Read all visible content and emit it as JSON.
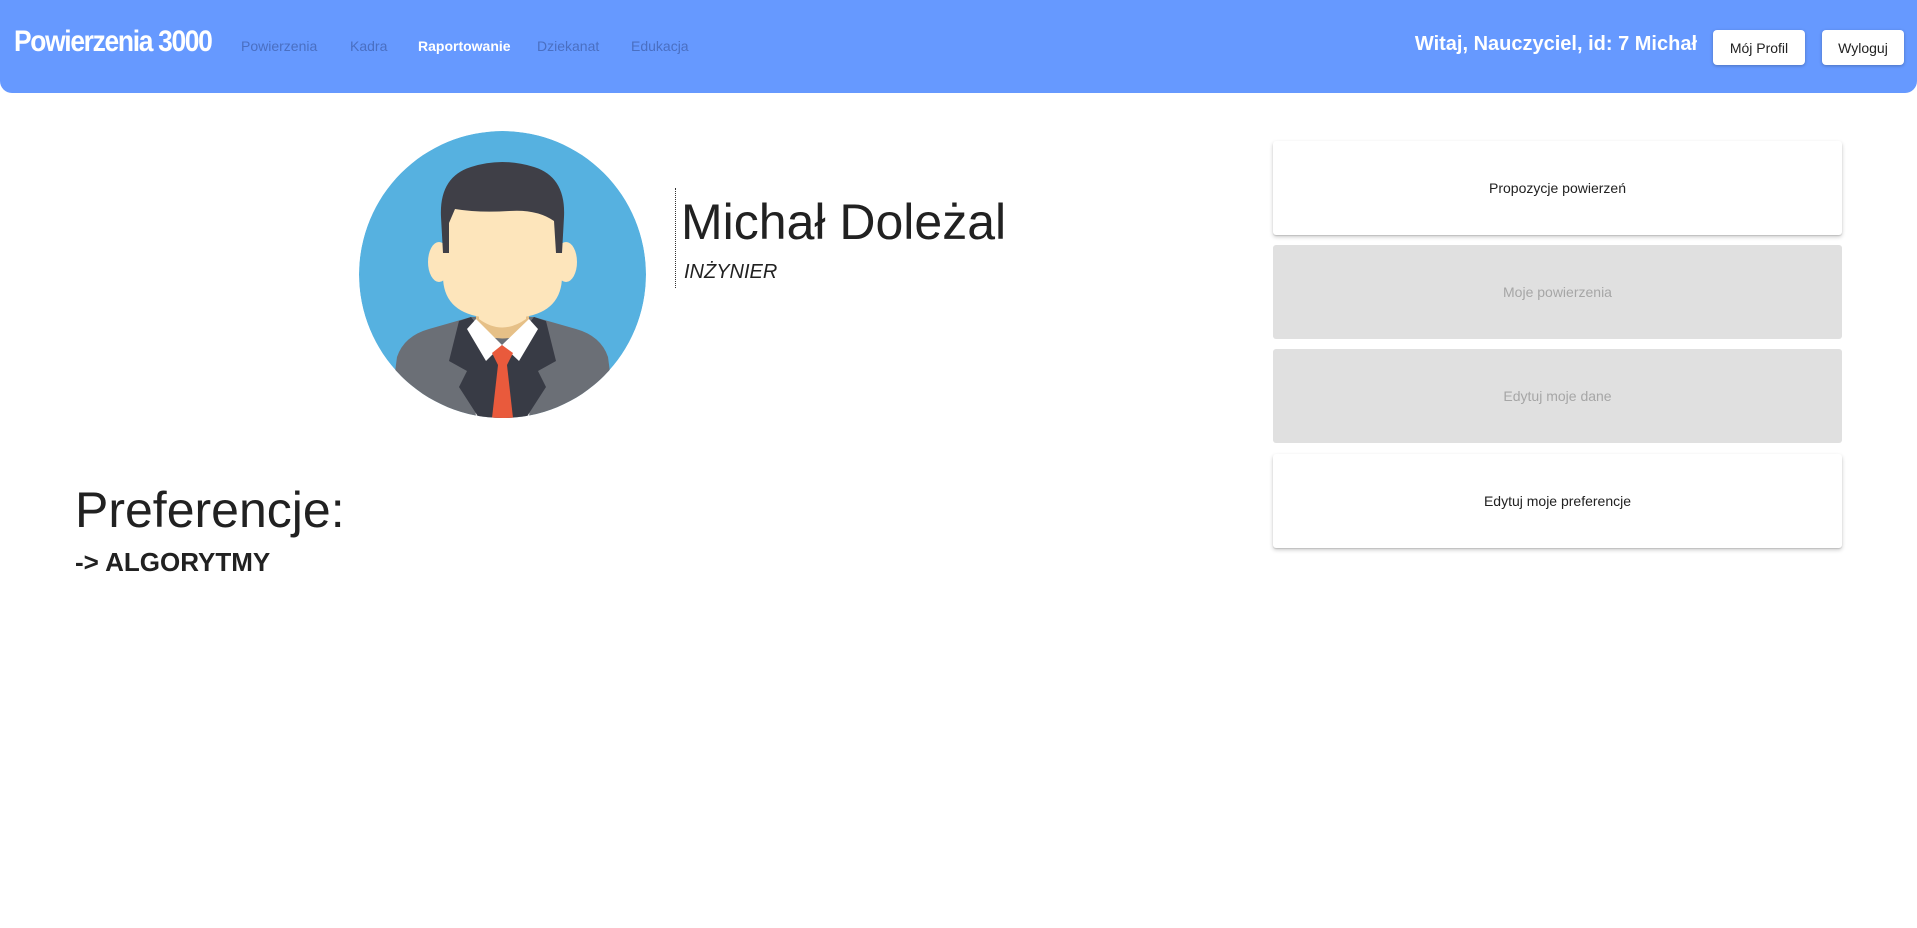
{
  "header": {
    "brand": "Powierzenia 3000",
    "nav": [
      {
        "label": "Powierzenia",
        "active": false
      },
      {
        "label": "Kadra",
        "active": false
      },
      {
        "label": "Raportowanie",
        "active": true
      },
      {
        "label": "Dziekanat",
        "active": false
      },
      {
        "label": "Edukacja",
        "active": false
      }
    ],
    "greeting": "Witaj, Nauczyciel, id: 7 Michał",
    "profile_button": "Mój Profil",
    "logout_button": "Wyloguj"
  },
  "profile": {
    "avatar_icon": "person-avatar-icon",
    "name": "Michał Doleżal",
    "title": "INŻYNIER"
  },
  "preferences": {
    "heading": "Preferencje:",
    "items": [
      "-> ALGORYTMY"
    ]
  },
  "actions": [
    {
      "label": "Propozycje powierzeń",
      "enabled": true
    },
    {
      "label": "Moje powierzenia",
      "enabled": false
    },
    {
      "label": "Edytuj moje dane",
      "enabled": false
    },
    {
      "label": "Edytuj moje preferencje",
      "enabled": true
    }
  ],
  "colors": {
    "header_bg": "#6699ff",
    "nav_inactive": "#4a6fc2",
    "card_disabled_bg": "#e0e0e0",
    "avatar_bg": "#56b1e0"
  }
}
